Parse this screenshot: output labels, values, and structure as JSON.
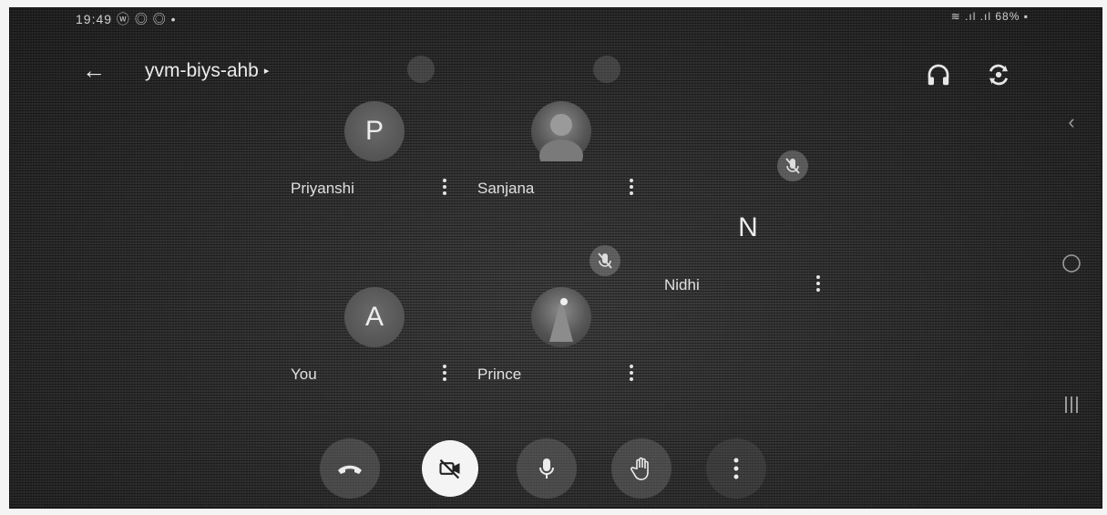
{
  "status_bar": {
    "time": "19:49 ⓦ ◎ ◎ •",
    "right": "≋ .ıl .ıl 68% ▪"
  },
  "header": {
    "back_icon": "arrow-left-icon",
    "meeting_code": "yvm-biys-ahb",
    "caret": "▸",
    "icons": [
      "headphones-icon",
      "switch-camera-icon"
    ]
  },
  "participants": [
    {
      "name": "Priyanshi",
      "initial": "P",
      "avatar": "letter"
    },
    {
      "name": "Sanjana",
      "initial": "",
      "avatar": "photo"
    },
    {
      "name": "Nidhi",
      "initial": "N",
      "avatar": "letter",
      "muted": true
    },
    {
      "name": "You",
      "initial": "A",
      "avatar": "letter"
    },
    {
      "name": "Prince",
      "initial": "",
      "avatar": "photo",
      "muted": true
    }
  ],
  "controls": [
    "end-call-icon",
    "camera-off-icon",
    "microphone-icon",
    "raise-hand-icon",
    "more-options-icon"
  ],
  "system_nav": [
    "nav-back-icon",
    "nav-home-icon",
    "nav-recents-icon"
  ],
  "colors": {
    "background": "#2b2b2b",
    "text": "#e6e6e6",
    "button": "#6e6e6e"
  }
}
